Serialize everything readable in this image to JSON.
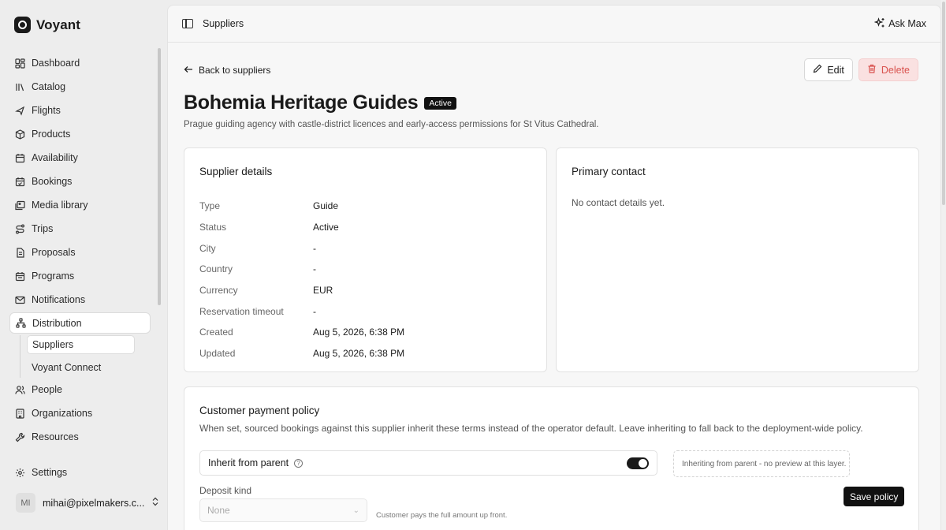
{
  "brand": {
    "name": "Voyant"
  },
  "sidebar": {
    "items": [
      {
        "label": "Dashboard",
        "icon": "dashboard-icon"
      },
      {
        "label": "Catalog",
        "icon": "library-icon"
      },
      {
        "label": "Flights",
        "icon": "plane-icon"
      },
      {
        "label": "Products",
        "icon": "package-icon"
      },
      {
        "label": "Availability",
        "icon": "calendar-icon"
      },
      {
        "label": "Bookings",
        "icon": "calendar-check-icon"
      },
      {
        "label": "Media library",
        "icon": "images-icon"
      },
      {
        "label": "Trips",
        "icon": "route-icon"
      },
      {
        "label": "Proposals",
        "icon": "file-text-icon"
      },
      {
        "label": "Programs",
        "icon": "calendar-range-icon"
      },
      {
        "label": "Notifications",
        "icon": "mail-icon"
      },
      {
        "label": "Distribution",
        "icon": "network-icon",
        "active": true
      }
    ],
    "sub_items": [
      {
        "label": "Suppliers",
        "active": true
      },
      {
        "label": "Voyant Connect"
      }
    ],
    "items_after": [
      {
        "label": "People",
        "icon": "users-icon"
      },
      {
        "label": "Organizations",
        "icon": "building-icon"
      },
      {
        "label": "Resources",
        "icon": "wrench-icon"
      }
    ],
    "settings": {
      "label": "Settings",
      "icon": "gear-icon"
    },
    "user": {
      "initials": "MI",
      "email": "mihai@pixelmakers.c..."
    }
  },
  "topbar": {
    "breadcrumb": "Suppliers",
    "ask_label": "Ask Max"
  },
  "page": {
    "back_label": "Back to suppliers",
    "edit_label": "Edit",
    "delete_label": "Delete",
    "title": "Bohemia Heritage Guides",
    "status_badge": "Active",
    "description": "Prague guiding agency with castle-district licences and early-access permissions for St Vitus Cathedral."
  },
  "supplier_details": {
    "title": "Supplier details",
    "rows": [
      {
        "key": "Type",
        "value": "Guide"
      },
      {
        "key": "Status",
        "value": "Active"
      },
      {
        "key": "City",
        "value": "-"
      },
      {
        "key": "Country",
        "value": "-"
      },
      {
        "key": "Currency",
        "value": "EUR"
      },
      {
        "key": "Reservation timeout",
        "value": "-"
      },
      {
        "key": "Created",
        "value": "Aug 5, 2026, 6:38 PM"
      },
      {
        "key": "Updated",
        "value": "Aug 5, 2026, 6:38 PM"
      }
    ]
  },
  "primary_contact": {
    "title": "Primary contact",
    "empty_text": "No contact details yet."
  },
  "payment_policy": {
    "title": "Customer payment policy",
    "description": "When set, sourced bookings against this supplier inherit these terms instead of the operator default. Leave inheriting to fall back to the deployment-wide policy.",
    "inherit_label": "Inherit from parent",
    "inherit_on": true,
    "preview_text": "Inheriting from parent - no preview at this layer.",
    "deposit_label": "Deposit kind",
    "deposit_value": "None",
    "deposit_hint": "Customer pays the full amount up front.",
    "save_label": "Save policy"
  }
}
